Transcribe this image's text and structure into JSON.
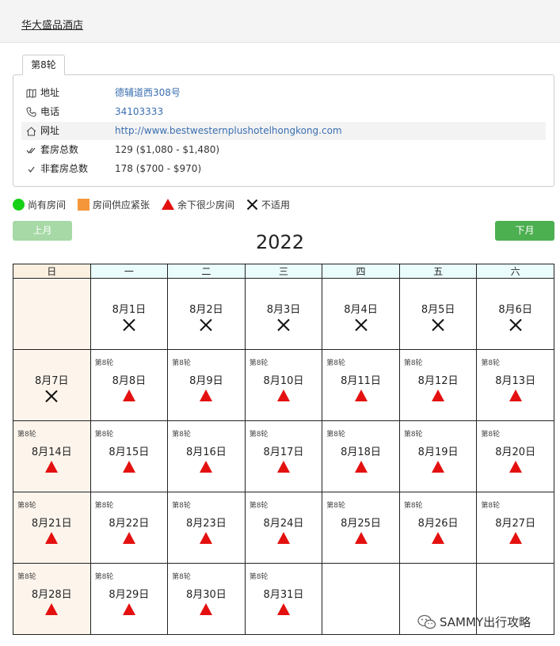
{
  "hotel": {
    "name": "华大盛品酒店"
  },
  "tab": {
    "label": "第8轮"
  },
  "info": {
    "rows": [
      {
        "icon": "map-icon",
        "label": "地址",
        "value": "德辅道西308号"
      },
      {
        "icon": "phone-icon",
        "label": "电话",
        "value": "34103333"
      },
      {
        "icon": "home-icon",
        "label": "网址",
        "value": "http://www.bestwesternplushotelhongkong.com"
      },
      {
        "icon": "double-check-icon",
        "label": "套房总数",
        "value": "129 ($1,080 - $1,480)"
      },
      {
        "icon": "check-icon",
        "label": "非套房总数",
        "value": "178 ($700 - $970)"
      }
    ]
  },
  "legend": {
    "available": "尚有房间",
    "tight": "房间供应紧张",
    "few": "余下很少房间",
    "na": "不适用"
  },
  "nav": {
    "prev": "上月",
    "next": "下月"
  },
  "calendar": {
    "year": "2022",
    "weekdays": [
      "日",
      "一",
      "二",
      "三",
      "四",
      "五",
      "六"
    ],
    "weeks": [
      [
        null,
        {
          "label": "8月1日",
          "status": "na"
        },
        {
          "label": "8月2日",
          "status": "na"
        },
        {
          "label": "8月3日",
          "status": "na"
        },
        {
          "label": "8月4日",
          "status": "na"
        },
        {
          "label": "8月5日",
          "status": "na"
        },
        {
          "label": "8月6日",
          "status": "na"
        }
      ],
      [
        {
          "label": "8月7日",
          "status": "na"
        },
        {
          "label": "8月8日",
          "status": "few",
          "round": "第8轮"
        },
        {
          "label": "8月9日",
          "status": "few",
          "round": "第8轮"
        },
        {
          "label": "8月10日",
          "status": "few",
          "round": "第8轮"
        },
        {
          "label": "8月11日",
          "status": "few",
          "round": "第8轮"
        },
        {
          "label": "8月12日",
          "status": "few",
          "round": "第8轮"
        },
        {
          "label": "8月13日",
          "status": "few",
          "round": "第8轮"
        }
      ],
      [
        {
          "label": "8月14日",
          "status": "few",
          "round": "第8轮"
        },
        {
          "label": "8月15日",
          "status": "few",
          "round": "第8轮"
        },
        {
          "label": "8月16日",
          "status": "few",
          "round": "第8轮"
        },
        {
          "label": "8月17日",
          "status": "few",
          "round": "第8轮"
        },
        {
          "label": "8月18日",
          "status": "few",
          "round": "第8轮"
        },
        {
          "label": "8月19日",
          "status": "few",
          "round": "第8轮"
        },
        {
          "label": "8月20日",
          "status": "few",
          "round": "第8轮"
        }
      ],
      [
        {
          "label": "8月21日",
          "status": "few",
          "round": "第8轮"
        },
        {
          "label": "8月22日",
          "status": "few",
          "round": "第8轮"
        },
        {
          "label": "8月23日",
          "status": "few",
          "round": "第8轮"
        },
        {
          "label": "8月24日",
          "status": "few",
          "round": "第8轮"
        },
        {
          "label": "8月25日",
          "status": "few",
          "round": "第8轮"
        },
        {
          "label": "8月26日",
          "status": "few",
          "round": "第8轮"
        },
        {
          "label": "8月27日",
          "status": "few",
          "round": "第8轮"
        }
      ],
      [
        {
          "label": "8月28日",
          "status": "few",
          "round": "第8轮"
        },
        {
          "label": "8月29日",
          "status": "few",
          "round": "第8轮"
        },
        {
          "label": "8月30日",
          "status": "few",
          "round": "第8轮"
        },
        {
          "label": "8月31日",
          "status": "few",
          "round": "第8轮"
        },
        null,
        null,
        null
      ]
    ]
  },
  "watermark": {
    "text": "SAMMY出行攻略",
    "icon": "wechat-icon"
  },
  "colors": {
    "available": "#16d116",
    "tight": "#f5963a",
    "few": "#e41010",
    "next_button": "#4caf50",
    "prev_button": "#a6d9a6",
    "link": "#3a6fb0",
    "sunday": "#fdf5ec",
    "weekday_header": "#eafcfc"
  }
}
